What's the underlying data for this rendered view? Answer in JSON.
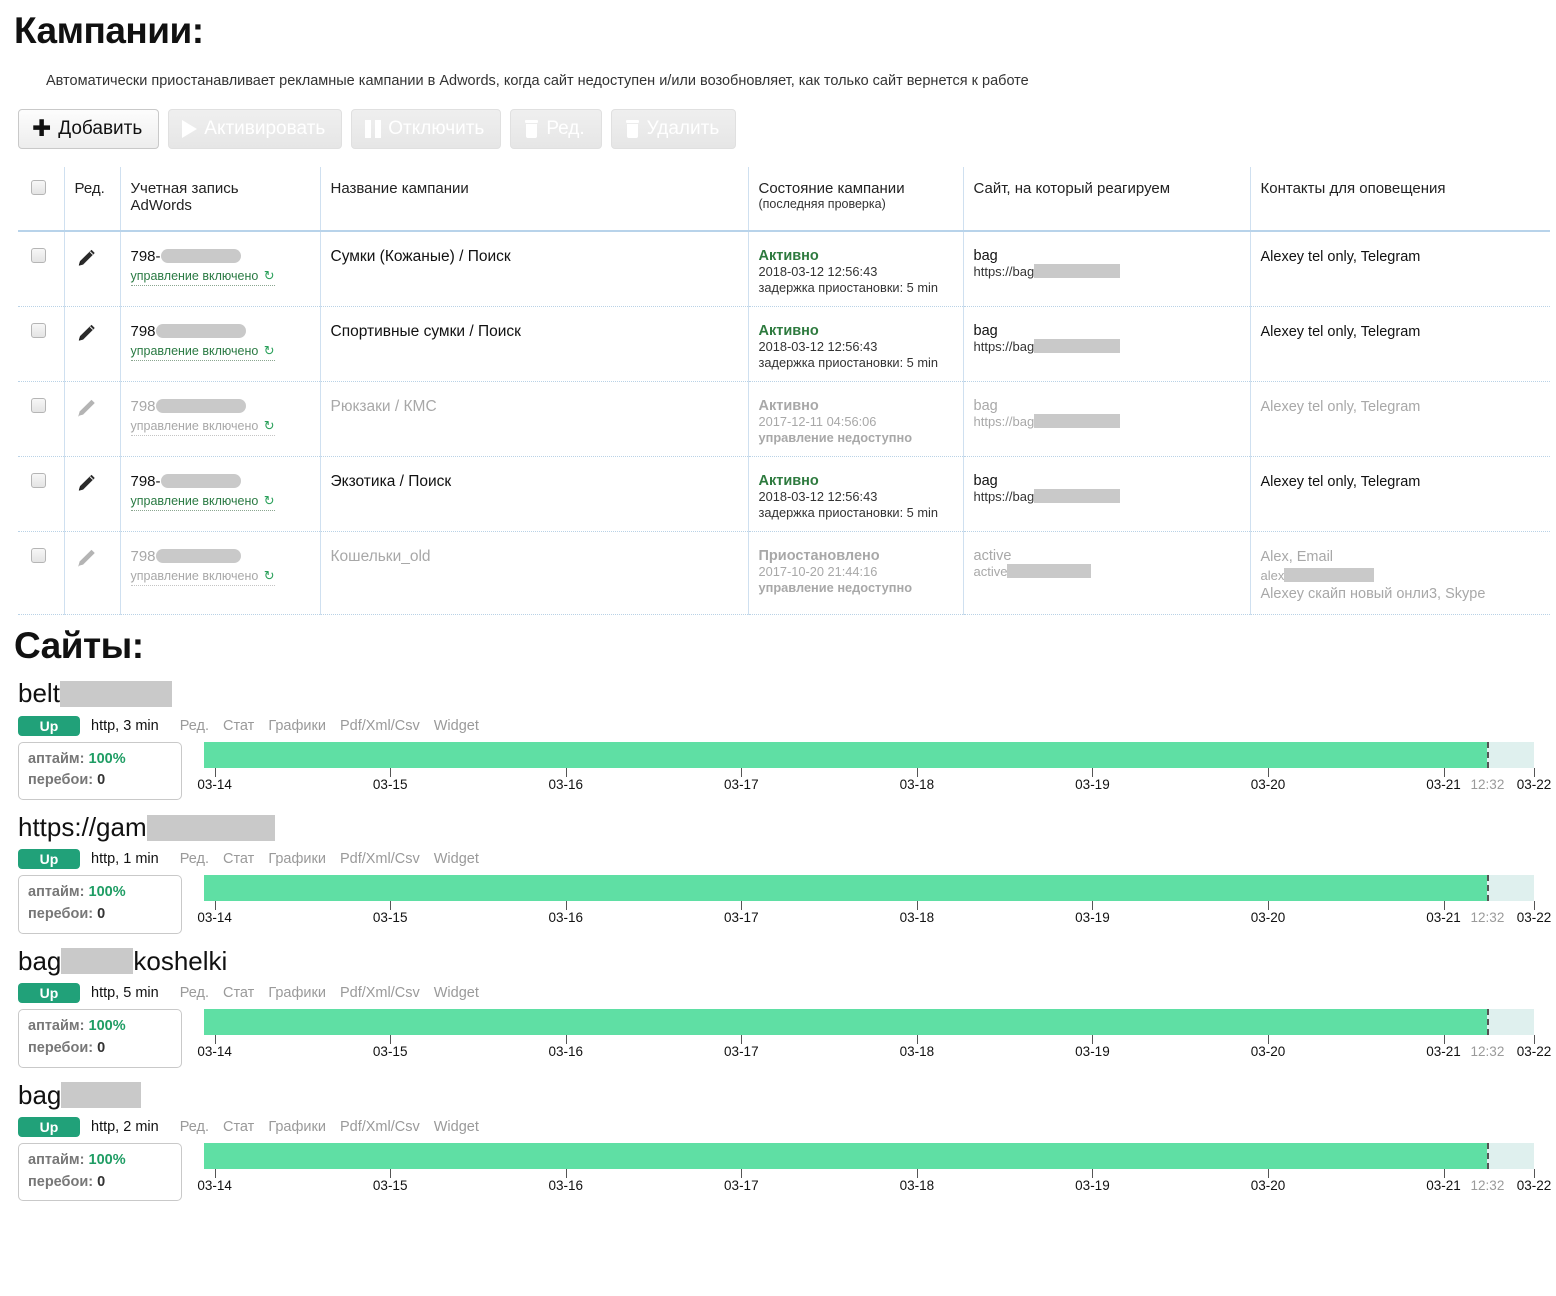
{
  "campaigns": {
    "heading": "Кампании:",
    "description": "Автоматически приостанавливает рекламные кампании в Adwords, когда сайт недоступен и/или возобновляет, как только сайт вернется к работе",
    "toolbar": [
      {
        "label": "Добавить",
        "icon": "plus-icon",
        "disabled": false
      },
      {
        "label": "Активировать",
        "icon": "play-icon",
        "disabled": true
      },
      {
        "label": "Отключить",
        "icon": "pause-icon",
        "disabled": true
      },
      {
        "label": "Ред.",
        "icon": "trash-icon",
        "disabled": true
      },
      {
        "label": "Удалить",
        "icon": "trash-icon",
        "disabled": true
      }
    ],
    "columns": {
      "edit": "Ред.",
      "account": "Учетная запись AdWords",
      "name": "Название кампании",
      "state": "Состояние кампании",
      "state_sub": "(последняя проверка)",
      "site": "Сайт, на который реагируем",
      "contacts": "Контакты для оповещения"
    },
    "mgmt_label": "управление включено",
    "refresh_icon": "↻",
    "rows": [
      {
        "account_prefix": "798-",
        "account_redacted_width": 80,
        "mgmt": "управление включено",
        "name": "Сумки (Кожаные) / Поиск",
        "state": "Активно",
        "state_time": "2018-03-12 12:56:43",
        "state_extra": "задержка приостановки: 5 min",
        "state_extra_bold": false,
        "site_name": "bag",
        "site_url_prefix": "https://bag",
        "site_redacted_width": 86,
        "contacts": "Alexey tel only, Telegram",
        "dim": false
      },
      {
        "account_prefix": "798",
        "account_redacted_width": 90,
        "mgmt": "управление включено",
        "name": "Спортивные сумки / Поиск",
        "state": "Активно",
        "state_time": "2018-03-12 12:56:43",
        "state_extra": "задержка приостановки: 5 min",
        "state_extra_bold": false,
        "site_name": "bag",
        "site_url_prefix": "https://bag",
        "site_redacted_width": 86,
        "contacts": "Alexey tel only, Telegram",
        "dim": false
      },
      {
        "account_prefix": "798",
        "account_redacted_width": 90,
        "mgmt": "управление включено",
        "name": "Рюкзаки / КМС",
        "state": "Активно",
        "state_time": "2017-12-11 04:56:06",
        "state_extra": "управление недоступно",
        "state_extra_bold": true,
        "site_name": "bag",
        "site_url_prefix": "https://bag",
        "site_redacted_width": 86,
        "contacts": "Alexey tel only, Telegram",
        "dim": true
      },
      {
        "account_prefix": "798-",
        "account_redacted_width": 80,
        "mgmt": "управление включено",
        "name": "Экзотика / Поиск",
        "state": "Активно",
        "state_time": "2018-03-12 12:56:43",
        "state_extra": "задержка приостановки: 5 min",
        "state_extra_bold": false,
        "site_name": "bag",
        "site_url_prefix": "https://bag",
        "site_redacted_width": 86,
        "contacts": "Alexey tel only, Telegram",
        "dim": false
      },
      {
        "account_prefix": "798",
        "account_redacted_width": 85,
        "mgmt": "управление включено",
        "name": "Кошельки_old",
        "state": "Приостановлено",
        "state_time": "2017-10-20 21:44:16",
        "state_extra": "управление недоступно",
        "state_extra_bold": true,
        "site_name": "active",
        "site_url_prefix": "active",
        "site_redacted_width": 84,
        "contacts": "Alex, Email",
        "contacts_sub_prefix": "alex",
        "contacts_sub_redacted_width": 90,
        "contacts_line3": "Alexey скайп новый онли3, Skype",
        "dim": true
      }
    ]
  },
  "sites": {
    "heading": "Сайты:",
    "link_labels": [
      "Ред.",
      "Стат",
      "Графики",
      "Pdf/Xml/Csv",
      "Widget"
    ],
    "uptime_label": "аптайм:",
    "outages_label": "перебои:",
    "items": [
      {
        "name_prefix": "belt",
        "name_redacted_width": 112,
        "status": "Up",
        "protocol": "http, 3 min",
        "uptime": "100%",
        "outages": "0"
      },
      {
        "name_prefix": "https://gam",
        "name_redacted_width": 128,
        "status": "Up",
        "protocol": "http, 1 min",
        "uptime": "100%",
        "outages": "0"
      },
      {
        "name_prefix": "bag",
        "name_redacted_width": 72,
        "name_suffix": "koshelki",
        "status": "Up",
        "protocol": "http, 5 min",
        "uptime": "100%",
        "outages": "0"
      },
      {
        "name_prefix": "bag",
        "name_redacted_width": 80,
        "status": "Up",
        "protocol": "http, 2 min",
        "uptime": "100%",
        "outages": "0"
      }
    ]
  },
  "chart_data": {
    "type": "bar",
    "title": "Uptime timeline",
    "xlabel": "",
    "ylabel": "",
    "grid": false,
    "legend": "none",
    "categories": [
      "03-14",
      "03-15",
      "03-16",
      "03-17",
      "03-18",
      "03-19",
      "03-20",
      "03-21",
      "03-22"
    ],
    "tick_positions_pct": [
      0.8,
      14.0,
      27.2,
      40.4,
      53.6,
      66.8,
      80.0,
      93.2,
      100.0
    ],
    "now_marker": {
      "label": "12:32",
      "position_pct": 96.5
    },
    "series": [
      {
        "name": "belt — uptime",
        "values": [
          100,
          100,
          100,
          100,
          100,
          100,
          100,
          100
        ],
        "uptime_pct": 100,
        "outages": 0
      },
      {
        "name": "https://gam — uptime",
        "values": [
          100,
          100,
          100,
          100,
          100,
          100,
          100,
          100
        ],
        "uptime_pct": 100,
        "outages": 0
      },
      {
        "name": "bag…koshelki — uptime",
        "values": [
          100,
          100,
          100,
          100,
          100,
          100,
          100,
          100
        ],
        "uptime_pct": 100,
        "outages": 0
      },
      {
        "name": "bag — uptime",
        "values": [
          100,
          100,
          100,
          100,
          100,
          100,
          100,
          100
        ],
        "uptime_pct": 100,
        "outages": 0
      }
    ],
    "colors": {
      "up": "#5fdfa4",
      "future": "#dff0ee",
      "badge": "#21a179",
      "accent": "#1f9d64"
    }
  }
}
